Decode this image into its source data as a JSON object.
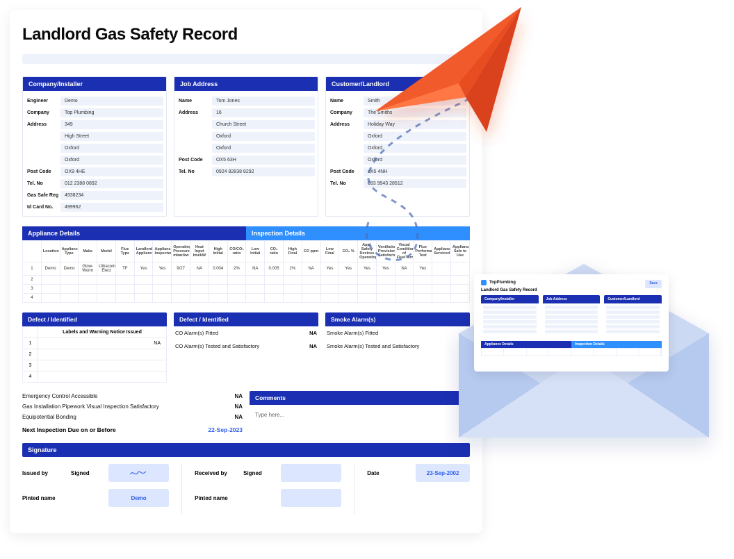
{
  "title": "Landlord Gas Safety Record",
  "company_card": {
    "header": "Company/Installer",
    "fields": [
      {
        "label": "Engineer",
        "value": "Demo"
      },
      {
        "label": "Company",
        "value": "Top Plumbing"
      },
      {
        "label": "Address",
        "value": "349"
      },
      {
        "label": "",
        "value": "High Street"
      },
      {
        "label": "",
        "value": "Oxford"
      },
      {
        "label": "",
        "value": "Oxford"
      },
      {
        "label": "Post Code",
        "value": "OX9 4HE"
      },
      {
        "label": "Tel. No",
        "value": "012 2388 0892"
      },
      {
        "label": "Gas Safe Reg",
        "value": "4938234"
      },
      {
        "label": "Id Card No.",
        "value": "499962"
      }
    ]
  },
  "job_card": {
    "header": "Job Address",
    "fields": [
      {
        "label": "Name",
        "value": "Tom Jones"
      },
      {
        "label": "Address",
        "value": "16"
      },
      {
        "label": "",
        "value": "Church Street"
      },
      {
        "label": "",
        "value": "Oxford"
      },
      {
        "label": "",
        "value": "Oxford"
      },
      {
        "label": "Post Code",
        "value": "OX5 63H"
      },
      {
        "label": "Tel. No",
        "value": "0924 82838 8292"
      }
    ]
  },
  "customer_card": {
    "header": "Customer/Landlord",
    "fields": [
      {
        "label": "Name",
        "value": "Smith"
      },
      {
        "label": "Company",
        "value": "The Smiths"
      },
      {
        "label": "Address",
        "value": "Holiday Way"
      },
      {
        "label": "",
        "value": "Oxford"
      },
      {
        "label": "",
        "value": "Oxford"
      },
      {
        "label": "",
        "value": "Oxford"
      },
      {
        "label": "Post Code",
        "value": "oX5 4NH"
      },
      {
        "label": "Tel. No",
        "value": "093 9943 28512"
      }
    ]
  },
  "appliance_header_left": "Appliance Details",
  "appliance_header_right": "Inspection Details",
  "big_table": {
    "headers": [
      "",
      "Location",
      "Appliance Type",
      "Make",
      "Model",
      "Flue Type",
      "Landlord Appliance",
      "Appliance Inspected",
      "Operating Pressure mbar/kw",
      "Heat Input btu/kW",
      "High Initial",
      "CO/CO₂ ratio",
      "Low Initial",
      "CO₂ ratio",
      "High Final",
      "CO ppm",
      "Low Final",
      "CO₂ %",
      "Appl. Safety Devices Operating",
      "Ventilation Provision Satisfactory",
      "Visual Condition of Flue/Termination",
      "Flue Performance Test",
      "Appliance Serviced",
      "Appliance Safe to Use"
    ],
    "rows": [
      [
        "1",
        "Demo",
        "Demo",
        "Glow-Worm",
        "Ultracom Elect",
        "TF",
        "Yes",
        "Yes",
        "9/27",
        "NA",
        "0.004",
        "2%",
        "NA",
        "0.005",
        "2%",
        "NA",
        "Yes",
        "Yes",
        "Yes",
        "Yes",
        "NA",
        "Yes"
      ],
      [
        "2",
        "",
        "",
        "",
        "",
        "",
        "",
        "",
        "",
        "",
        "",
        "",
        "",
        "",
        "",
        "",
        "",
        "",
        "",
        "",
        "",
        ""
      ],
      [
        "3",
        "",
        "",
        "",
        "",
        "",
        "",
        "",
        "",
        "",
        "",
        "",
        "",
        "",
        "",
        "",
        "",
        "",
        "",
        "",
        "",
        ""
      ],
      [
        "4",
        "",
        "",
        "",
        "",
        "",
        "",
        "",
        "",
        "",
        "",
        "",
        "",
        "",
        "",
        "",
        "",
        "",
        "",
        "",
        "",
        ""
      ]
    ]
  },
  "defect1": {
    "header": "Defect / Identified",
    "col_header": "Labels and Warning Notice Issued",
    "rows": [
      {
        "n": "1",
        "v": "NA"
      },
      {
        "n": "2",
        "v": ""
      },
      {
        "n": "3",
        "v": ""
      },
      {
        "n": "4",
        "v": ""
      }
    ]
  },
  "defect2": {
    "header": "Defect / Identified",
    "rows": [
      {
        "l": "CO Alarm(s) Fitted",
        "r": "NA"
      },
      {
        "l": "CO Alarm(s) Tested and Satisfactory",
        "r": "NA"
      }
    ]
  },
  "smoke": {
    "header": "Smoke Alarm(s)",
    "rows": [
      {
        "l": "Smoke Alarm(s) Fitted",
        "r": ""
      },
      {
        "l": "Smoke Alarm(s) Tested and Satisfactory",
        "r": ""
      }
    ]
  },
  "checks": [
    {
      "txt": "Emergency Control Accessible",
      "na": "NA"
    },
    {
      "txt": "Gas Installation Pipework Visual Inspection Satisfactory",
      "na": "NA"
    },
    {
      "txt": "Equipotential Bonding",
      "na": "NA"
    }
  ],
  "inspection_due_label": "Next Inspection Due on or Before",
  "inspection_due_value": "22-Sep-2023",
  "comments": {
    "header": "Comments",
    "placeholder": "Type here..."
  },
  "signature_header": "Signature",
  "sig": {
    "issued_by": "Issued by",
    "received_by": "Received by",
    "signed": "Signed",
    "printed_name": "Pinted name",
    "date_label": "Date",
    "date_value": "23-Sep-2002",
    "printed_value": "Demo"
  },
  "thumb": {
    "brand": "TopPlumbing",
    "title": "Landlord Gas Safety Record",
    "button": "Save",
    "headers": [
      "Company/Installer",
      "Job Address",
      "Customer/Landlord"
    ],
    "appliance_left": "Appliance Details",
    "appliance_right": "Inspection Details"
  }
}
